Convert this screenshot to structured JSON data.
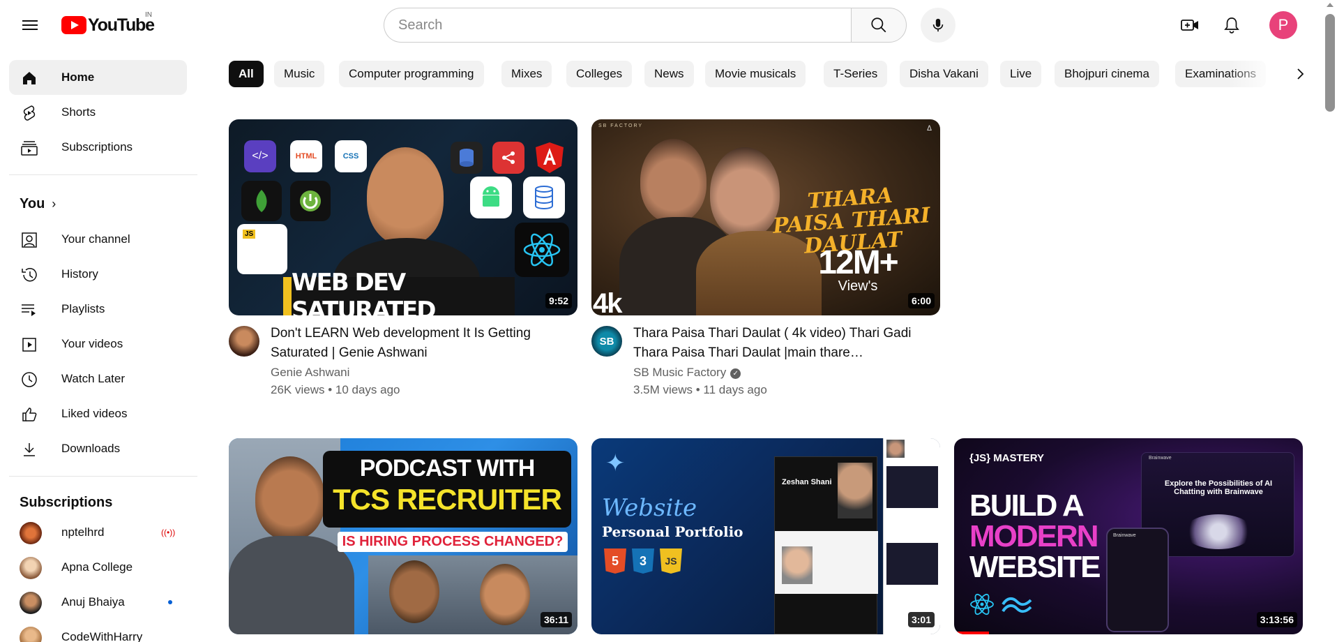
{
  "header": {
    "logo_text": "YouTube",
    "country_code": "IN",
    "search_placeholder": "Search",
    "avatar_letter": "P"
  },
  "sidebar": {
    "main": [
      {
        "label": "Home",
        "icon": "home-icon",
        "active": true
      },
      {
        "label": "Shorts",
        "icon": "shorts-icon"
      },
      {
        "label": "Subscriptions",
        "icon": "subscriptions-icon"
      }
    ],
    "you_heading": "You",
    "you_items": [
      {
        "label": "Your channel",
        "icon": "your-channel-icon"
      },
      {
        "label": "History",
        "icon": "history-icon"
      },
      {
        "label": "Playlists",
        "icon": "playlists-icon"
      },
      {
        "label": "Your videos",
        "icon": "your-videos-icon"
      },
      {
        "label": "Watch Later",
        "icon": "watch-later-icon"
      },
      {
        "label": "Liked videos",
        "icon": "liked-videos-icon"
      },
      {
        "label": "Downloads",
        "icon": "downloads-icon"
      }
    ],
    "subscriptions_heading": "Subscriptions",
    "subscriptions": [
      {
        "label": "nptelhrd",
        "status": "live",
        "color": "#8a3b1a"
      },
      {
        "label": "Apna College",
        "status": "",
        "color": "#c9a37a"
      },
      {
        "label": "Anuj Bhaiya",
        "status": "new",
        "color": "#3a3a3a"
      },
      {
        "label": "CodeWithHarry",
        "status": "",
        "color": "#d9a66b"
      }
    ]
  },
  "chips": [
    "All",
    "Music",
    "Computer programming",
    "Mixes",
    "Colleges",
    "News",
    "Movie musicals",
    "T-Series",
    "Disha Vakani",
    "Live",
    "Bhojpuri cinema",
    "Examinations"
  ],
  "videos": [
    {
      "title": "Don't LEARN Web development It Is Getting Saturated | Genie Ashwani",
      "channel": "Genie Ashwani",
      "verified": false,
      "stats": "26K views • 10 days ago",
      "duration": "9:52",
      "thumb_text": "WEB DEV SATURATED",
      "thumb_badges": [
        "JS",
        "HTML",
        "CSS"
      ]
    },
    {
      "title": "Thara Paisa Thari Daulat ( 4k video) Thari Gadi Thara Paisa Thari Daulat |main thare…",
      "channel": "SB Music Factory",
      "verified": true,
      "stats": "3.5M views • 11 days ago",
      "duration": "6:00",
      "thumb_text": "THARA PAISA THARI DAULAT",
      "thumb_views": "12M+",
      "thumb_views_label": "View's",
      "thumb_quality": "4k",
      "thumb_brand": "SB FACTORY",
      "avatar_text": "SB"
    },
    {
      "duration": "36:11",
      "thumb_line1": "PODCAST WITH",
      "thumb_line2": "TCS RECRUITER",
      "thumb_line3": "IS HIRING PROCESS CHANGED?"
    },
    {
      "duration": "3:01",
      "thumb_line1": "Website",
      "thumb_line2": "Personal Portfolio",
      "thumb_name": "Zeshan Shani",
      "thumb_badges": [
        "5",
        "3",
        "JS"
      ]
    },
    {
      "duration": "3:13:56",
      "thumb_brand": "{JS} MASTERY",
      "thumb_line1": "BUILD A",
      "thumb_line2": "MODERN",
      "thumb_line3": "WEBSITE",
      "thumb_sub": "Explore the Possibilities of AI Chatting with Brainwave",
      "thumb_app": "Brainwave"
    }
  ],
  "colors": {
    "brand_red": "#ff0000",
    "active_chip_bg": "#0f0f0f",
    "chip_bg": "#f2f2f2",
    "avatar_bg": "#e8427a"
  }
}
